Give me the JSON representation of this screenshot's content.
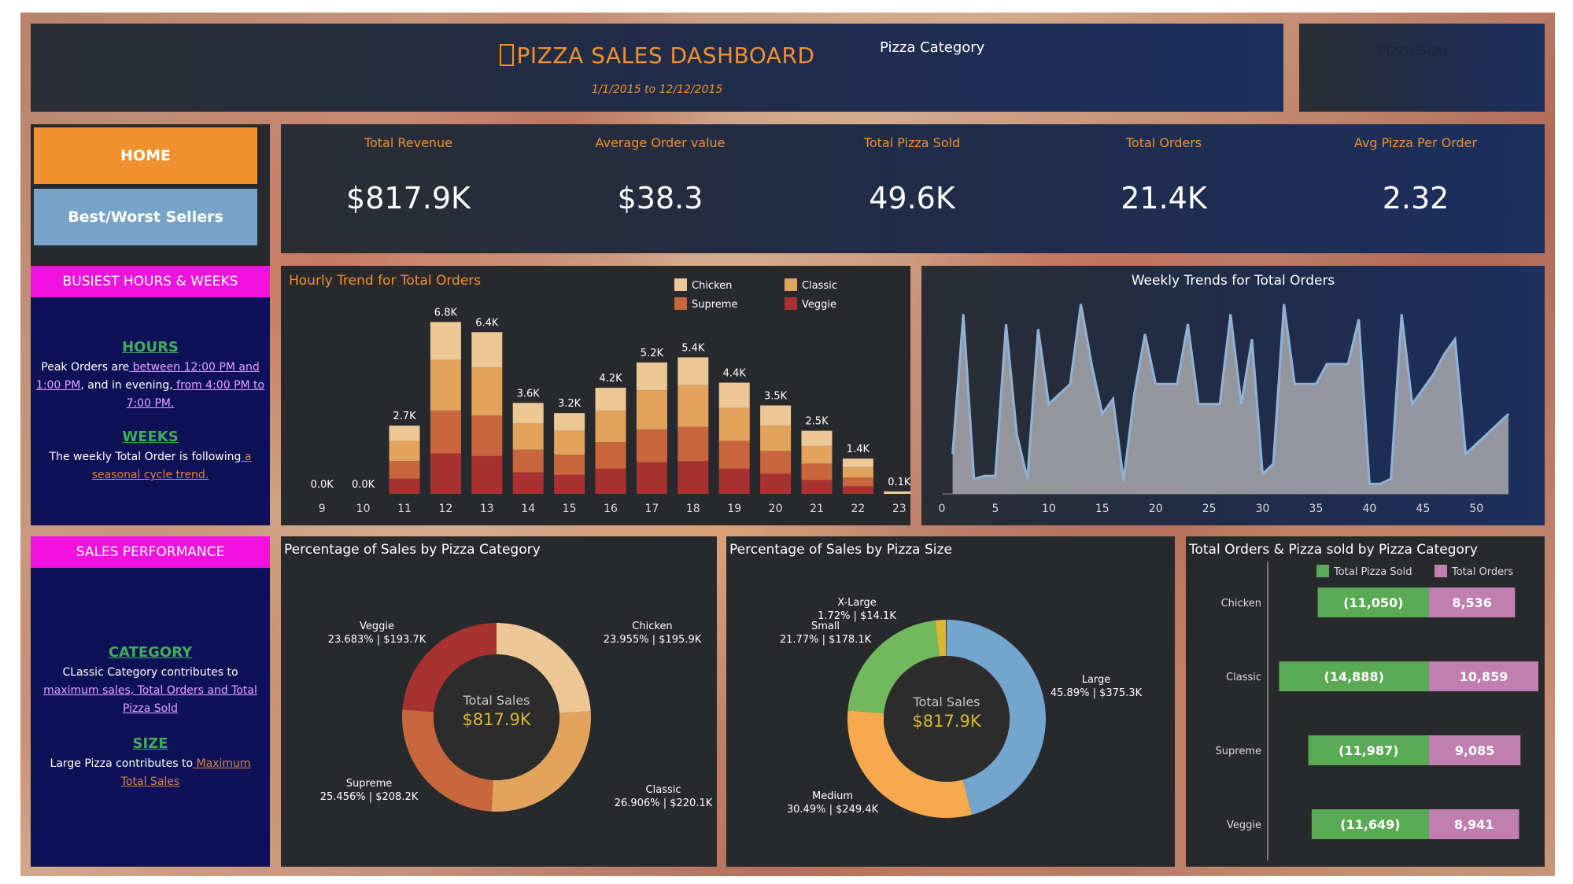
{
  "header": {
    "title": "PIZZA SALES DASHBOARD",
    "title_icon": "pizza-icon",
    "date_range": "1/1/2015 to 12/12/2015",
    "filter1_label": "Pizza Category",
    "filter2_label": "Pizza Size"
  },
  "nav": {
    "home": "HOME",
    "bestworst": "Best/Worst Sellers"
  },
  "kpis": [
    {
      "label": "Total Revenue",
      "value": "$817.9K"
    },
    {
      "label": "Average Order value",
      "value": "$38.3"
    },
    {
      "label": "Total Pizza Sold",
      "value": "49.6K"
    },
    {
      "label": "Total Orders",
      "value": "21.4K"
    },
    {
      "label": "Avg Pizza Per Order",
      "value": "2.32"
    }
  ],
  "busiest": {
    "header": "BUSIEST HOURS & WEEKS",
    "hours_title": "HOURS",
    "hours_t1": "Peak Orders are",
    "hours_l1": " between 12:00 PM and 1:00 PM",
    "hours_t2": ", and in evening,",
    "hours_l2": " from 4:00 PM to 7:00 PM.",
    "weeks_title": "WEEKS",
    "weeks_t1": "The weekly Total Order is following",
    "weeks_l1": " a seasonal cycle trend."
  },
  "sales_perf": {
    "header": "SALES PERFORMANCE",
    "cat_title": "CATEGORY",
    "cat_t1": "CLassic Category contributes to",
    "cat_l1": "maximum sales, Total Orders and Total Pizza Sold",
    "size_title": "SIZE",
    "size_t1": "Large Pizza contributes to",
    "size_l1": " Maximum Total Sales"
  },
  "colors": {
    "chicken": "#ecc896",
    "classic": "#e2a35c",
    "supreme": "#c8663d",
    "veggie": "#a83232",
    "accent": "#f1902e",
    "magenta": "#f212e0",
    "line": "#8fb3d6",
    "area": "#a9a9ae",
    "large": "#74a5cf",
    "medium": "#f6a94d",
    "small": "#72b85d",
    "xlarge": "#d8b736",
    "green": "#5aaa55",
    "pink": "#c07fb0"
  },
  "chart_data": [
    {
      "id": "hourly",
      "type": "bar",
      "stacked": true,
      "title": "Hourly Trend for Total Orders",
      "categories": [
        "9",
        "10",
        "11",
        "12",
        "13",
        "14",
        "15",
        "16",
        "17",
        "18",
        "19",
        "20",
        "21",
        "22",
        "23"
      ],
      "totals_labels": [
        "0.0K",
        "0.0K",
        "2.7K",
        "6.8K",
        "6.4K",
        "3.6K",
        "3.2K",
        "4.2K",
        "5.2K",
        "5.4K",
        "4.4K",
        "3.5K",
        "2.5K",
        "1.4K",
        "0.1K"
      ],
      "legend_position": "top-right",
      "series": [
        {
          "name": "Chicken",
          "values": [
            0,
            0,
            600,
            1500,
            1400,
            800,
            700,
            900,
            1100,
            1100,
            1000,
            800,
            600,
            350,
            20
          ]
        },
        {
          "name": "Classic",
          "values": [
            0,
            0,
            800,
            2000,
            1900,
            1050,
            950,
            1250,
            1550,
            1650,
            1300,
            1000,
            700,
            400,
            30
          ]
        },
        {
          "name": "Supreme",
          "values": [
            0,
            0,
            700,
            1700,
            1600,
            900,
            800,
            1050,
            1300,
            1350,
            1100,
            900,
            650,
            350,
            25
          ]
        },
        {
          "name": "Veggie",
          "values": [
            0,
            0,
            600,
            1600,
            1500,
            850,
            750,
            1000,
            1250,
            1300,
            1000,
            800,
            550,
            300,
            25
          ]
        }
      ],
      "ylim": [
        0,
        7000
      ]
    },
    {
      "id": "weekly",
      "type": "area",
      "title": "Weekly Trends for Total Orders",
      "x": [
        1,
        2,
        3,
        4,
        5,
        6,
        7,
        8,
        9,
        10,
        11,
        12,
        13,
        14,
        15,
        16,
        17,
        18,
        19,
        20,
        21,
        22,
        23,
        24,
        25,
        26,
        27,
        28,
        29,
        30,
        31,
        32,
        33,
        34,
        35,
        36,
        37,
        38,
        39,
        40,
        41,
        42,
        43,
        44,
        45,
        46,
        47,
        48,
        49,
        50,
        51,
        52,
        53
      ],
      "values": [
        280,
        420,
        255,
        258,
        258,
        410,
        300,
        255,
        405,
        330,
        340,
        350,
        430,
        370,
        320,
        335,
        253,
        340,
        400,
        350,
        350,
        350,
        410,
        330,
        330,
        330,
        420,
        330,
        395,
        260,
        270,
        430,
        350,
        350,
        350,
        370,
        370,
        370,
        415,
        250,
        250,
        255,
        420,
        330,
        345,
        360,
        380,
        395,
        280,
        290,
        300,
        310,
        320
      ],
      "xticks": [
        0,
        5,
        10,
        15,
        20,
        25,
        30,
        35,
        40,
        45,
        50
      ],
      "xlim": [
        0,
        53
      ],
      "ylim": [
        240,
        440
      ],
      "grid": false
    },
    {
      "id": "category_pie",
      "type": "pie",
      "donut": true,
      "title": "Percentage of Sales by Pizza Category",
      "center_label": "Total Sales",
      "center_value": "$817.9K",
      "slices": [
        {
          "name": "Chicken",
          "percent": 23.955,
          "label": "23.955%  |  $195.9K"
        },
        {
          "name": "Classic",
          "percent": 26.906,
          "label": "26.906%  |  $220.1K"
        },
        {
          "name": "Supreme",
          "percent": 25.456,
          "label": "25.456%  |  $208.2K"
        },
        {
          "name": "Veggie",
          "percent": 23.683,
          "label": "23.683%  |  $193.7K"
        }
      ]
    },
    {
      "id": "size_pie",
      "type": "pie",
      "donut": true,
      "title": "Percentage of Sales by Pizza Size",
      "center_label": "Total Sales",
      "center_value": "$817.9K",
      "slices": [
        {
          "name": "Large",
          "percent": 45.89,
          "label": "45.89%  | $375.3K"
        },
        {
          "name": "Medium",
          "percent": 30.49,
          "label": "30.49%  | $249.4K"
        },
        {
          "name": "Small",
          "percent": 21.77,
          "label": "21.77%  | $178.1K"
        },
        {
          "name": "X-Large",
          "percent": 1.72,
          "label": "1.72%  | $14.1K"
        }
      ]
    },
    {
      "id": "cat_orders",
      "type": "bar",
      "stacked": true,
      "orientation": "horizontal",
      "title": "Total Orders & Pizza sold by Pizza Category",
      "categories": [
        "Chicken",
        "Classic",
        "Supreme",
        "Veggie"
      ],
      "series": [
        {
          "name": "Total Pizza Sold",
          "values": [
            11050,
            14888,
            11987,
            11649
          ],
          "labels": [
            "(11,050)",
            "(14,888)",
            "(11,987)",
            "(11,649)"
          ]
        },
        {
          "name": "Total Orders",
          "values": [
            8536,
            10859,
            9085,
            8941
          ],
          "labels": [
            "8,536",
            "10,859",
            "9,085",
            "8,941"
          ]
        }
      ],
      "legend_position": "top",
      "diverging": true
    }
  ]
}
